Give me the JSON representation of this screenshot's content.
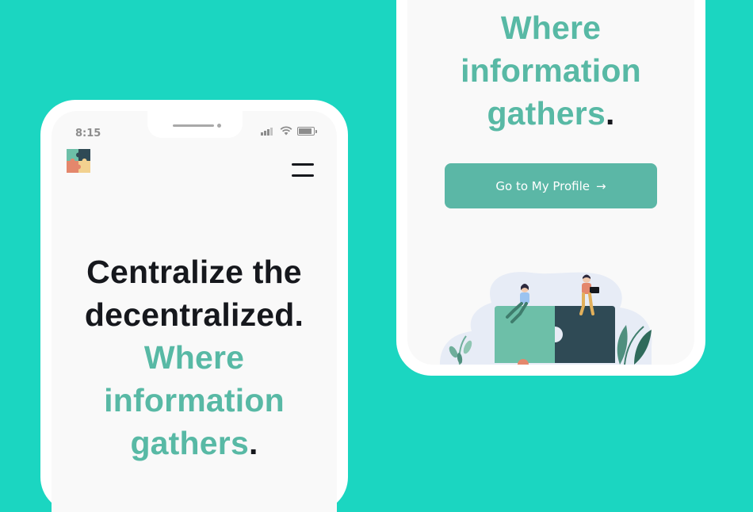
{
  "status_bar": {
    "time": "8:15"
  },
  "hero": {
    "line1": "Centralize the",
    "line2": "decentralized",
    "line2_period": ".",
    "line3": "Where",
    "line4": "information",
    "line5": "gathers",
    "line5_period": "."
  },
  "cta": {
    "label": "Go to My Profile",
    "arrow": "→"
  },
  "colors": {
    "background": "#1bd6c1",
    "accent_teal": "#58b9a5",
    "button": "#5bb7a6",
    "text_dark": "#16181d"
  },
  "icons": [
    "logo-puzzle-icon",
    "hamburger-menu-icon",
    "signal-icon",
    "wifi-icon",
    "battery-icon",
    "arrow-right-icon"
  ]
}
